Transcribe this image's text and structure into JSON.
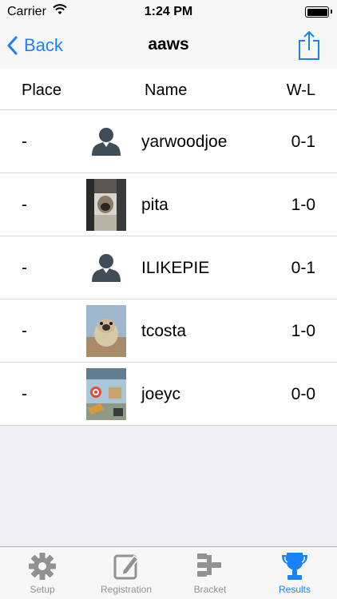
{
  "status_bar": {
    "carrier": "Carrier",
    "time": "1:24 PM",
    "wifi_icon": "wifi-icon",
    "battery_icon": "battery-icon"
  },
  "nav": {
    "back_label": "Back",
    "title": "aaws",
    "share_icon": "share-icon",
    "accent_color": "#1a82f7"
  },
  "table": {
    "headers": {
      "place": "Place",
      "name": "Name",
      "wl": "W-L"
    },
    "rows": [
      {
        "place": "-",
        "name": "yarwoodjoe",
        "wl": "0-1",
        "avatar": "default-person-avatar"
      },
      {
        "place": "-",
        "name": "pita",
        "wl": "1-0",
        "avatar": "photo-avatar"
      },
      {
        "place": "-",
        "name": "ILIKEPIE",
        "wl": "0-1",
        "avatar": "default-person-avatar"
      },
      {
        "place": "-",
        "name": "tcosta",
        "wl": "1-0",
        "avatar": "photo-avatar"
      },
      {
        "place": "-",
        "name": "joeyc",
        "wl": "0-0",
        "avatar": "photo-avatar"
      }
    ]
  },
  "tab_bar": {
    "tabs": [
      {
        "label": "Setup",
        "icon": "gear-icon",
        "active": false
      },
      {
        "label": "Registration",
        "icon": "edit-icon",
        "active": false
      },
      {
        "label": "Bracket",
        "icon": "bracket-icon",
        "active": false
      },
      {
        "label": "Results",
        "icon": "trophy-icon",
        "active": true
      }
    ]
  }
}
